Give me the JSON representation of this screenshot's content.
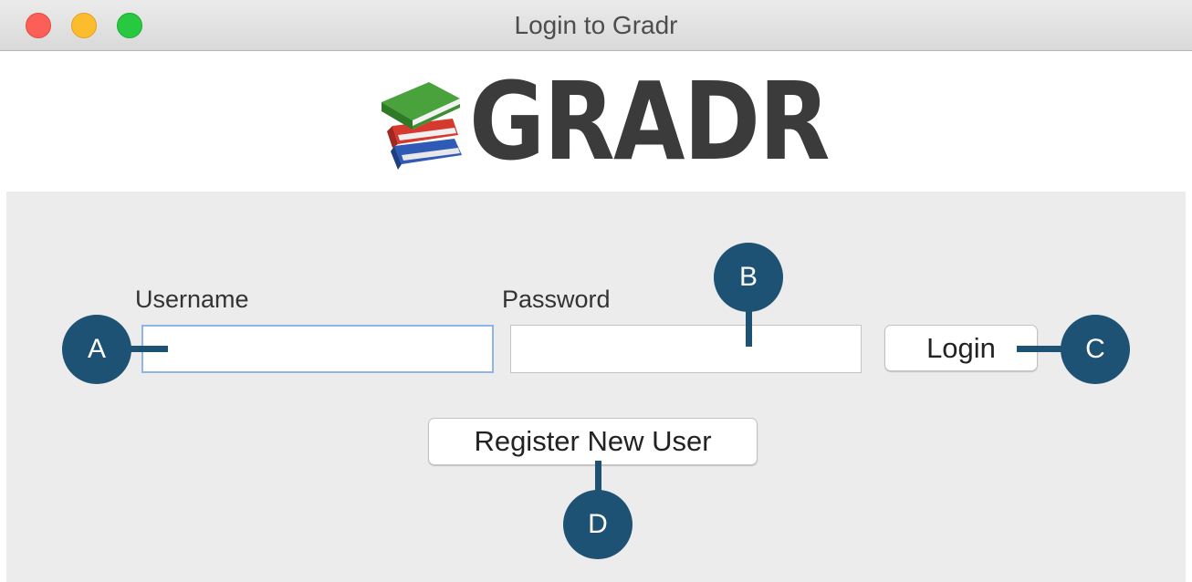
{
  "window": {
    "title": "Login to Gradr"
  },
  "logo": {
    "text": "GRADR",
    "icon": "books-icon"
  },
  "form": {
    "username_label": "Username",
    "username_value": "",
    "password_label": "Password",
    "password_value": "",
    "login_button": "Login",
    "register_button": "Register New User"
  },
  "callouts": {
    "a": "A",
    "b": "B",
    "c": "C",
    "d": "D"
  },
  "colors": {
    "callout": "#1d5274",
    "focus_ring": "#8db6e6",
    "form_background": "#ececec",
    "close": "#fc5f57",
    "minimize": "#fdbc2e",
    "maximize": "#28c840"
  }
}
